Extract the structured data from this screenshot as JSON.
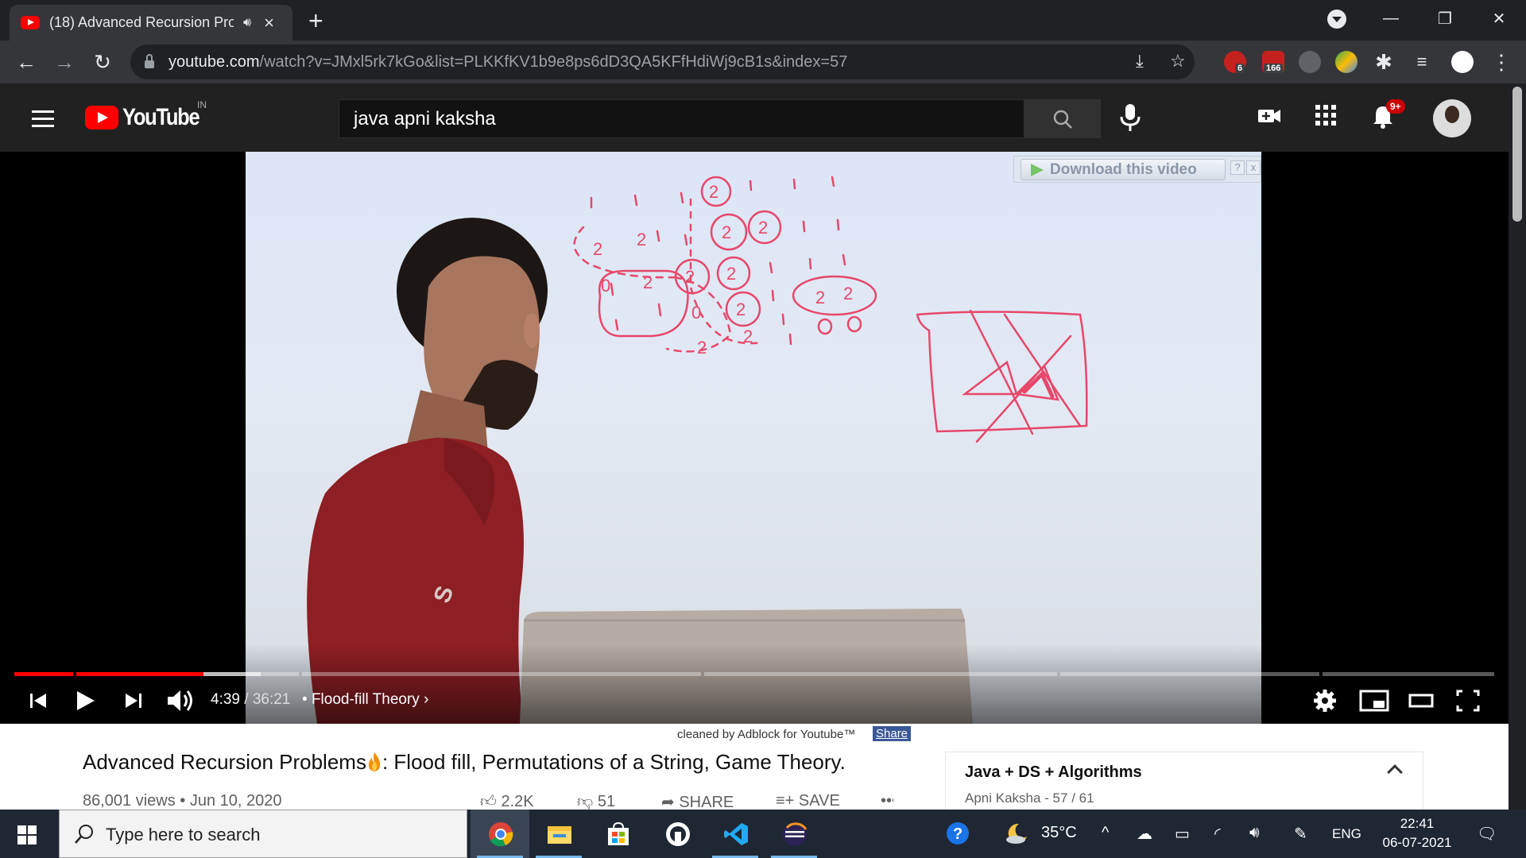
{
  "browser": {
    "tab_title": "(18) Advanced Recursion Pro",
    "tab_audio_icon": "speaker-icon",
    "address_host": "youtube.com",
    "address_path": "/watch?v=JMxl5rk7kGo&list=PLKKfKV1b9e8ps6dD3QA5KFfHdiWj9cB1s&index=57",
    "ext_abp_badge": "6",
    "ext_counter_badge": "166"
  },
  "youtube": {
    "logo_text": "YouTube",
    "country": "IN",
    "search_query": "java apni kaksha",
    "notification_badge": "9+"
  },
  "player": {
    "download_overlay": "Download this video",
    "download_help": "?",
    "download_close": "x",
    "current_time": "4:39",
    "duration": "36:21",
    "chapter": "Flood-fill Theory",
    "progress_fraction": 0.128
  },
  "video": {
    "adblock_note": "cleaned by Adblock for Youtube™",
    "adblock_share": "Share",
    "title_part1": "Advanced Recursion Problems",
    "title_part2": ": Flood fill, Permutations of a String, Game Theory.",
    "meta": "86,001 views • Jun 10, 2020",
    "likes": "2.2K",
    "dislikes": "51",
    "share_label": "SHARE",
    "save_label": "SAVE"
  },
  "playlist": {
    "title": "Java + DS + Algorithms",
    "subtitle": "Apni Kaksha - 57 / 61"
  },
  "taskbar": {
    "search_placeholder": "Type here to search",
    "temperature": "35°C",
    "language": "ENG",
    "time": "22:41",
    "date": "06-07-2021"
  },
  "colors": {
    "youtube_red": "#ff0000",
    "marker_pink": "#e8476a",
    "progress_red": "#ff0000"
  }
}
